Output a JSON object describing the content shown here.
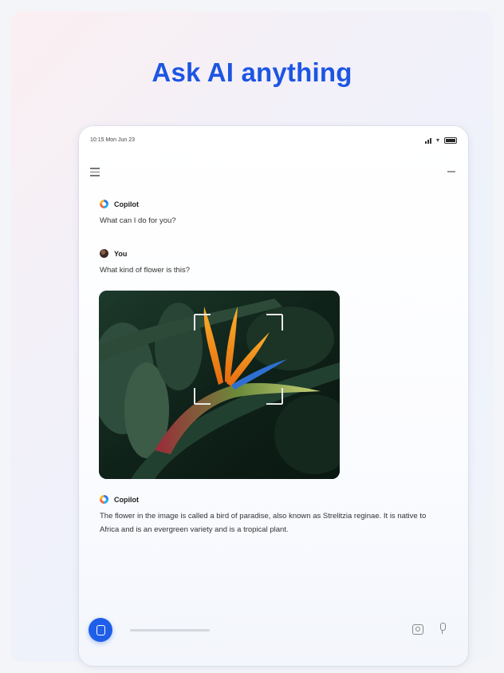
{
  "headline": "Ask AI anything",
  "status_bar": {
    "time": "10:15 Mon Jun 23"
  },
  "conversation": [
    {
      "sender": "Copilot",
      "text": "What can I do for you?"
    },
    {
      "sender": "You",
      "text": "What kind of flower is this?"
    },
    {
      "sender": "Copilot",
      "text": "The flower in the image is called a bird of paradise, also known as Strelitzia reginae. It is native to Africa and is an evergreen variety and is a tropical plant."
    }
  ],
  "icons": {
    "menu": "hamburger-icon",
    "minimize": "minus-icon",
    "new_chat": "new-chat-icon",
    "camera": "camera-icon",
    "microphone": "microphone-icon"
  },
  "colors": {
    "accent": "#1f5ee8",
    "headline": "#1d55e3"
  }
}
